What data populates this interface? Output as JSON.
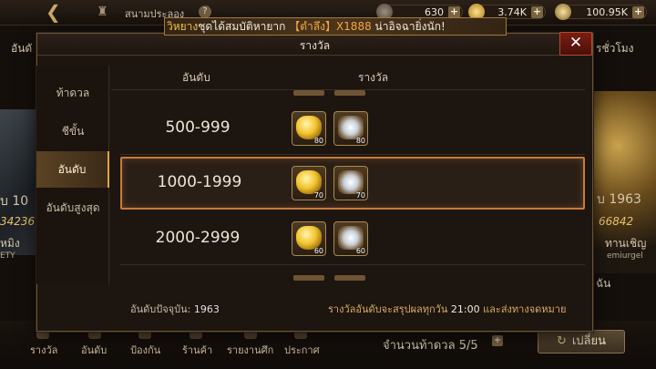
{
  "top_bar": {
    "back_icon": "arrow-left-icon",
    "scene_icon": "castle-icon",
    "title": "สนามประลอง",
    "help_icon": "help-icon",
    "resources": [
      {
        "icon": "silver-coin-icon",
        "value": "630"
      },
      {
        "icon": "gold-ingot-icon",
        "value": "3.74K"
      },
      {
        "icon": "gold-coin-icon",
        "value": "100.95K"
      }
    ]
  },
  "announcement": {
    "player": "วิหยาง",
    "text_before": "ชุดได้สมบัติหายาก ",
    "item": "【ตำลึง】X1888",
    "text_after": " น่าอิจฉายิ่งนัก!"
  },
  "background": {
    "left_label": "อันดั",
    "right_label": "รชั่วโมง",
    "left_rank": "ับ 10",
    "left_score": "34236",
    "left_name": "หมิง",
    "left_sub": "ETY",
    "right_rank": "บ 1963",
    "right_score": "66842",
    "right_name": "ทานเชิญ",
    "right_sub": "emiurgel",
    "right_bottom": "ฉัน"
  },
  "modal": {
    "title": "รางวัล",
    "close_icon": "close-icon",
    "side_tabs": [
      {
        "label": "ท้าดวล",
        "active": false
      },
      {
        "label": "ชีขั้น",
        "active": false
      },
      {
        "label": "อันดับ",
        "active": true
      },
      {
        "label": "อันดับสูงสุด",
        "active": false
      }
    ],
    "columns": {
      "rank": "อันดับ",
      "reward": "รางวัล"
    },
    "rows": [
      {
        "rank": "500-999",
        "rewards": [
          {
            "icon": "gold-ingot-icon",
            "qty": "80"
          },
          {
            "icon": "wing-crest-icon",
            "qty": "80"
          }
        ]
      },
      {
        "rank": "1000-1999",
        "highlight": true,
        "rewards": [
          {
            "icon": "gold-ingot-icon",
            "qty": "70"
          },
          {
            "icon": "wing-crest-icon",
            "qty": "70"
          }
        ]
      },
      {
        "rank": "2000-2999",
        "rewards": [
          {
            "icon": "gold-ingot-icon",
            "qty": "60"
          },
          {
            "icon": "wing-crest-icon",
            "qty": "60"
          }
        ]
      }
    ],
    "footer": {
      "current_rank_label": "อันดับปัจจุบัน:",
      "current_rank_value": "1963",
      "note_before": "รางวัลอันดับจะสรุปผลทุกวัน ",
      "note_time": "21:00",
      "note_after": " และส่งทางจดหมาย"
    }
  },
  "bottom_bar": {
    "nav": [
      "รางวัล",
      "อันดับ",
      "ป้องกัน",
      "ร้านค้า",
      "รายงานศึก",
      "ประกาศ"
    ],
    "attempts": "จำนวนท้าดวล 5/5",
    "attempts_plus": "+",
    "change_label": "เปลี่ยน",
    "change_icon": "refresh-icon"
  },
  "colors": {
    "accent_gold": "#e0a54e",
    "highlight_border": "#c57b3a",
    "close_red": "#7a1e12"
  }
}
